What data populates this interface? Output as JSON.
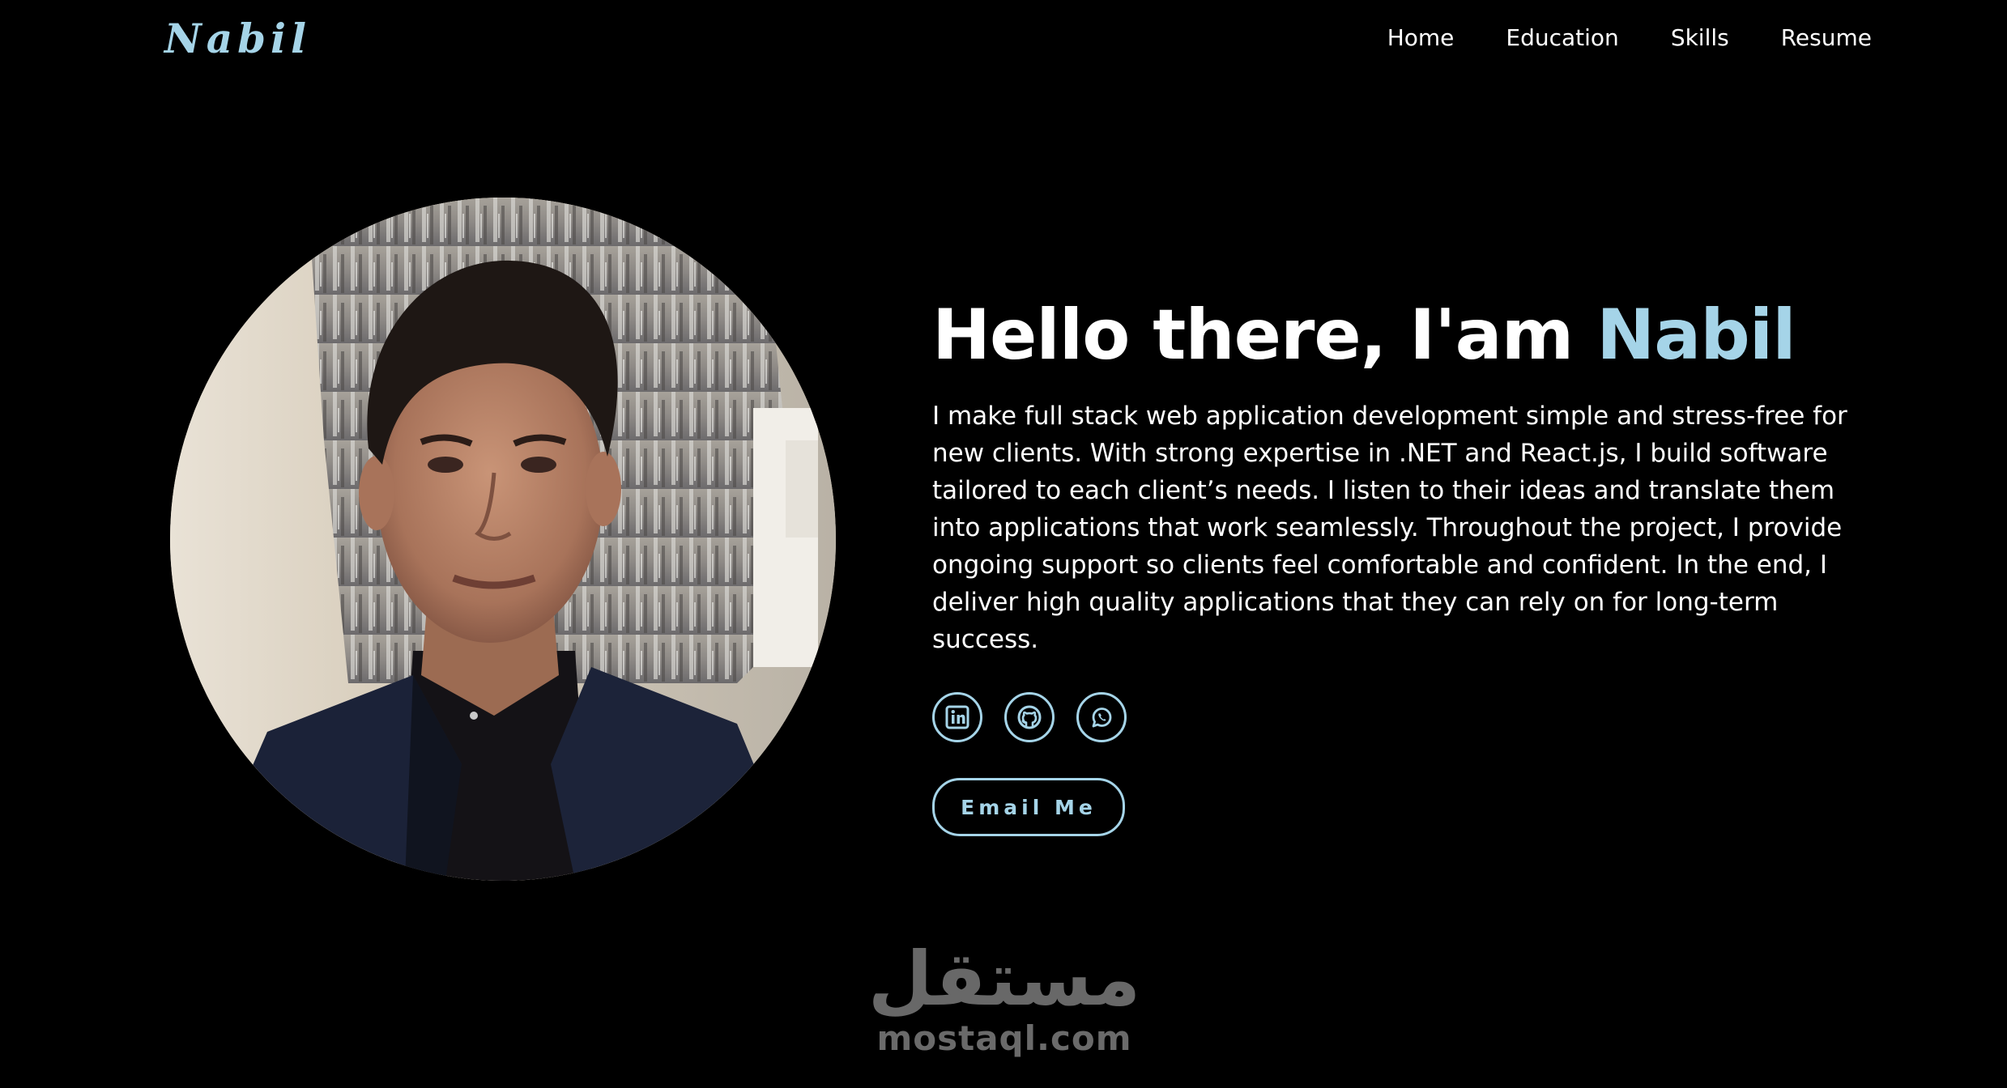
{
  "nav": {
    "logo": "Nabil",
    "links": [
      "Home",
      "Education",
      "Skills",
      "Resume"
    ]
  },
  "hero": {
    "greeting": "Hello there, I'am ",
    "name": "Nabil",
    "bio": "I make full stack web application development simple and stress-free for new clients. With strong expertise in .NET and React.js, I build software tailored to each client’s needs. I listen to their ideas and translate them into applications that work seamlessly. Throughout the project, I provide ongoing support so clients feel comfortable and confident. In the end, I deliver high quality applications that they can rely on for long-term success.",
    "socials": [
      "linkedin-icon",
      "github-icon",
      "whatsapp-icon"
    ],
    "email_button": "Email Me"
  },
  "watermark": {
    "arabic": "مستقل",
    "latin": "mostaql.com"
  },
  "colors": {
    "background": "#000000",
    "accent": "#a5d4e8",
    "text": "#ffffff"
  }
}
